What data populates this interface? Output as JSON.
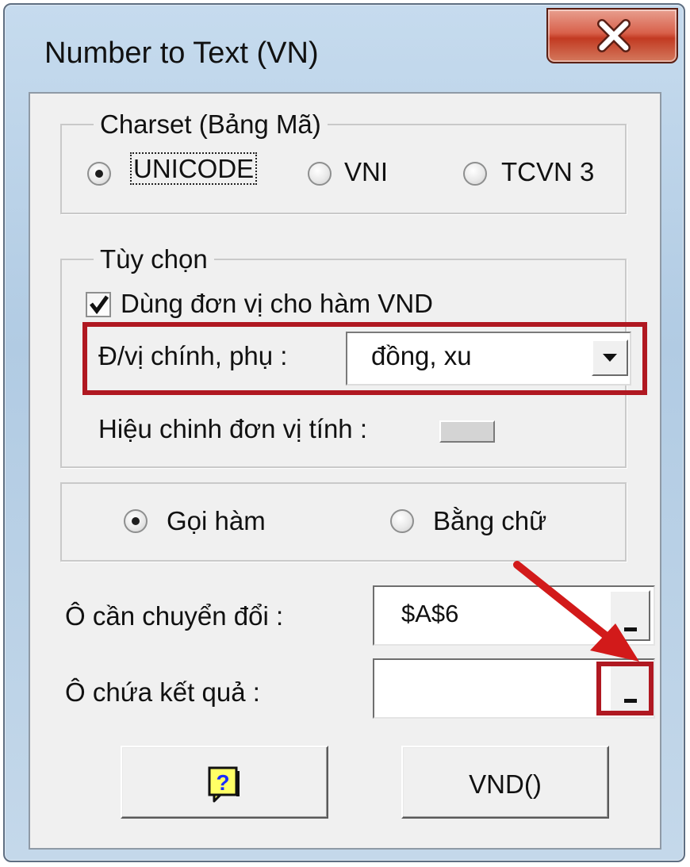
{
  "window": {
    "title": "Number to Text (VN)"
  },
  "charset": {
    "legend": "Charset (Bảng Mã)",
    "options": [
      "UNICODE",
      "VNI",
      "TCVN 3"
    ],
    "selected": "UNICODE"
  },
  "options_group": {
    "legend": "Tùy chọn",
    "use_unit_label": "Dùng đơn vị cho hàm VND",
    "use_unit_checked": true,
    "unit_label": "Đ/vị chính, phụ :",
    "unit_value": "đồng, xu",
    "adjust_label": "Hiệu chinh đơn vị tính :"
  },
  "mode": {
    "options": [
      "Gọi hàm",
      "Bằng chữ"
    ],
    "selected": "Gọi hàm"
  },
  "source": {
    "label": "Ô cần chuyển đổi :",
    "value": "$A$6"
  },
  "result": {
    "label": "Ô chứa kết quả :",
    "value": ""
  },
  "buttons": {
    "help_icon": "help-question-icon",
    "vnd_label": "VND()"
  },
  "colors": {
    "highlight_red": "#b01821",
    "arrow_red": "#d21a1a",
    "dialog_bg": "#f0f0f0"
  }
}
